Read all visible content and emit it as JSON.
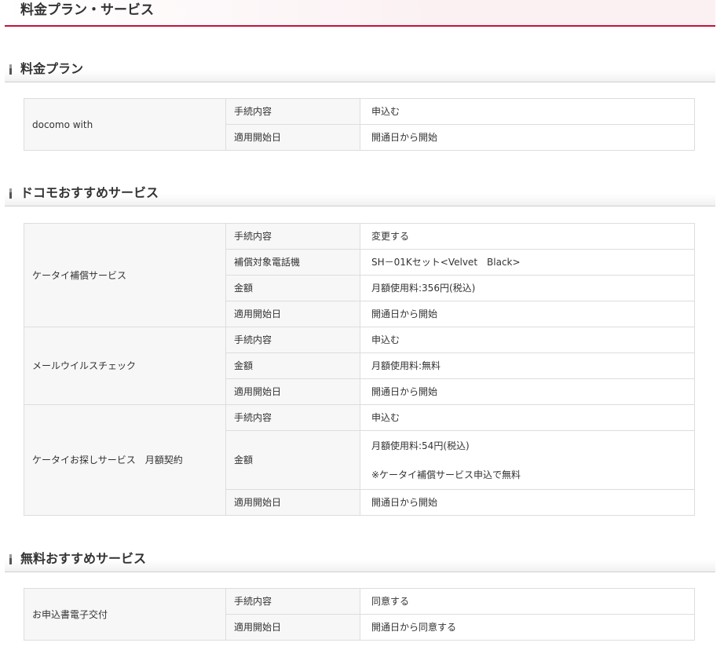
{
  "page": {
    "title": "料金プラン・サービス"
  },
  "sections": [
    {
      "heading": "料金プラン",
      "groups": [
        {
          "name": "docomo with",
          "rows": [
            {
              "item": "手続内容",
              "value": "申込む"
            },
            {
              "item": "適用開始日",
              "value": "開通日から開始"
            }
          ]
        }
      ]
    },
    {
      "heading": "ドコモおすすめサービス",
      "groups": [
        {
          "name": "ケータイ補償サービス",
          "rows": [
            {
              "item": "手続内容",
              "value": "変更する"
            },
            {
              "item": "補償対象電話機",
              "value": "SH－01Kセット<Velvet　Black>"
            },
            {
              "item": "金額",
              "value": "月額使用料:356円(税込)"
            },
            {
              "item": "適用開始日",
              "value": "開通日から開始"
            }
          ]
        },
        {
          "name": "メールウイルスチェック",
          "rows": [
            {
              "item": "手続内容",
              "value": "申込む"
            },
            {
              "item": "金額",
              "value": "月額使用料:無料"
            },
            {
              "item": "適用開始日",
              "value": "開通日から開始"
            }
          ]
        },
        {
          "name": "ケータイお探しサービス　月額契約",
          "rows": [
            {
              "item": "手続内容",
              "value": "申込む"
            },
            {
              "item": "金額",
              "value": "月額使用料:54円(税込)",
              "note": "※ケータイ補償サービス申込で無料"
            },
            {
              "item": "適用開始日",
              "value": "開通日から開始"
            }
          ]
        }
      ]
    },
    {
      "heading": "無料おすすめサービス",
      "groups": [
        {
          "name": "お申込書電子交付",
          "rows": [
            {
              "item": "手続内容",
              "value": "同意する"
            },
            {
              "item": "適用開始日",
              "value": "開通日から同意する"
            }
          ]
        }
      ]
    }
  ]
}
